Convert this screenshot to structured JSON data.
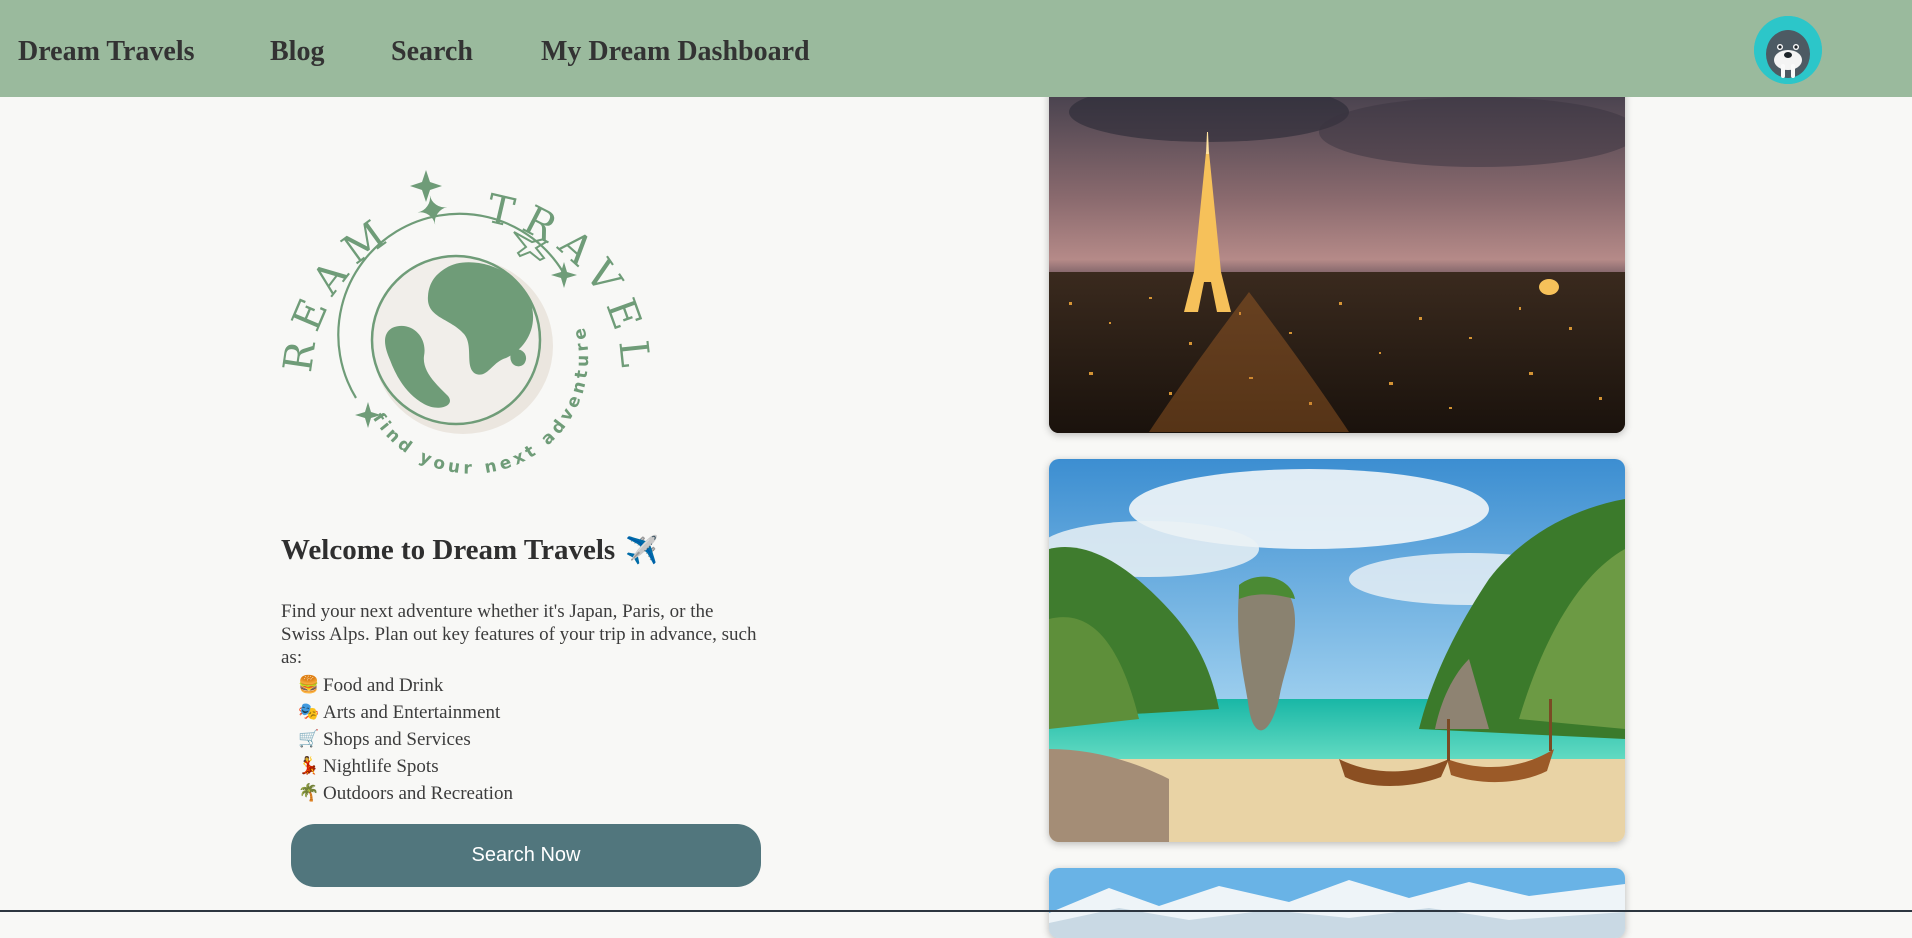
{
  "nav": {
    "brand": "Dream Travels",
    "links": [
      "Blog",
      "Search",
      "My Dream Dashboard"
    ],
    "avatar_icon": "walrus-avatar-icon"
  },
  "logo": {
    "arc_text": "DREAM ✦ TRAVELS",
    "tagline": "find your next adventure",
    "color": "#6f9c78"
  },
  "welcome": {
    "title": "Welcome to Dream Travels",
    "title_icon": "✈️",
    "intro": "Find your next adventure whether it's Japan, Paris, or the Swiss Alps. Plan out key features of your trip in advance, such as:",
    "features": [
      {
        "icon": "🍔",
        "label": "Food and Drink"
      },
      {
        "icon": "🎭",
        "label": "Arts and Entertainment"
      },
      {
        "icon": "🛒",
        "label": "Shops and Services"
      },
      {
        "icon": "💃",
        "label": "Nightlife Spots"
      },
      {
        "icon": "🌴",
        "label": "Outdoors and Recreation"
      }
    ],
    "button_label": "Search Now"
  },
  "colors": {
    "nav_bg": "#9aba9d",
    "page_bg": "#f8f8f6",
    "button_bg": "#51767d",
    "avatar_bg": "#2cc6c9"
  },
  "images": [
    {
      "name": "paris-night-photo"
    },
    {
      "name": "thailand-beach-photo"
    },
    {
      "name": "swiss-alps-photo"
    }
  ]
}
